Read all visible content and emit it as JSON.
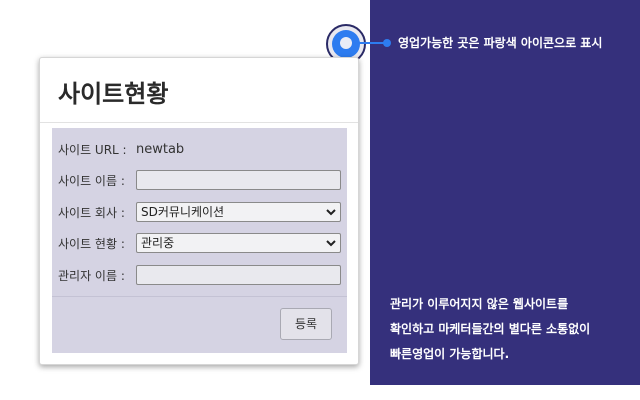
{
  "callout": {
    "text": "영업가능한 곳은 파랑색 아이콘으로 표시"
  },
  "side_note": {
    "lines": [
      "관리가 이루어지지 않은 웹사이트를",
      "확인하고 마케터들간의 별다른 소통없이",
      "빠른영업이 가능합니다."
    ]
  },
  "panel": {
    "title": "사이트현황",
    "fields": {
      "url_label": "사이트 URL :",
      "url_value": "newtab",
      "name_label": "사이트 이름 :",
      "name_value": "",
      "company_label": "사이트 회사 :",
      "company_value": "SD커뮤니케이션",
      "status_label": "사이트 현황 :",
      "status_value": "관리중",
      "manager_label": "관리자 이름 :",
      "manager_value": ""
    },
    "submit_label": "등록"
  },
  "colors": {
    "frame": "#35307c",
    "accent_blue": "#2d7cf0",
    "form_bg": "#d5d3e3"
  }
}
